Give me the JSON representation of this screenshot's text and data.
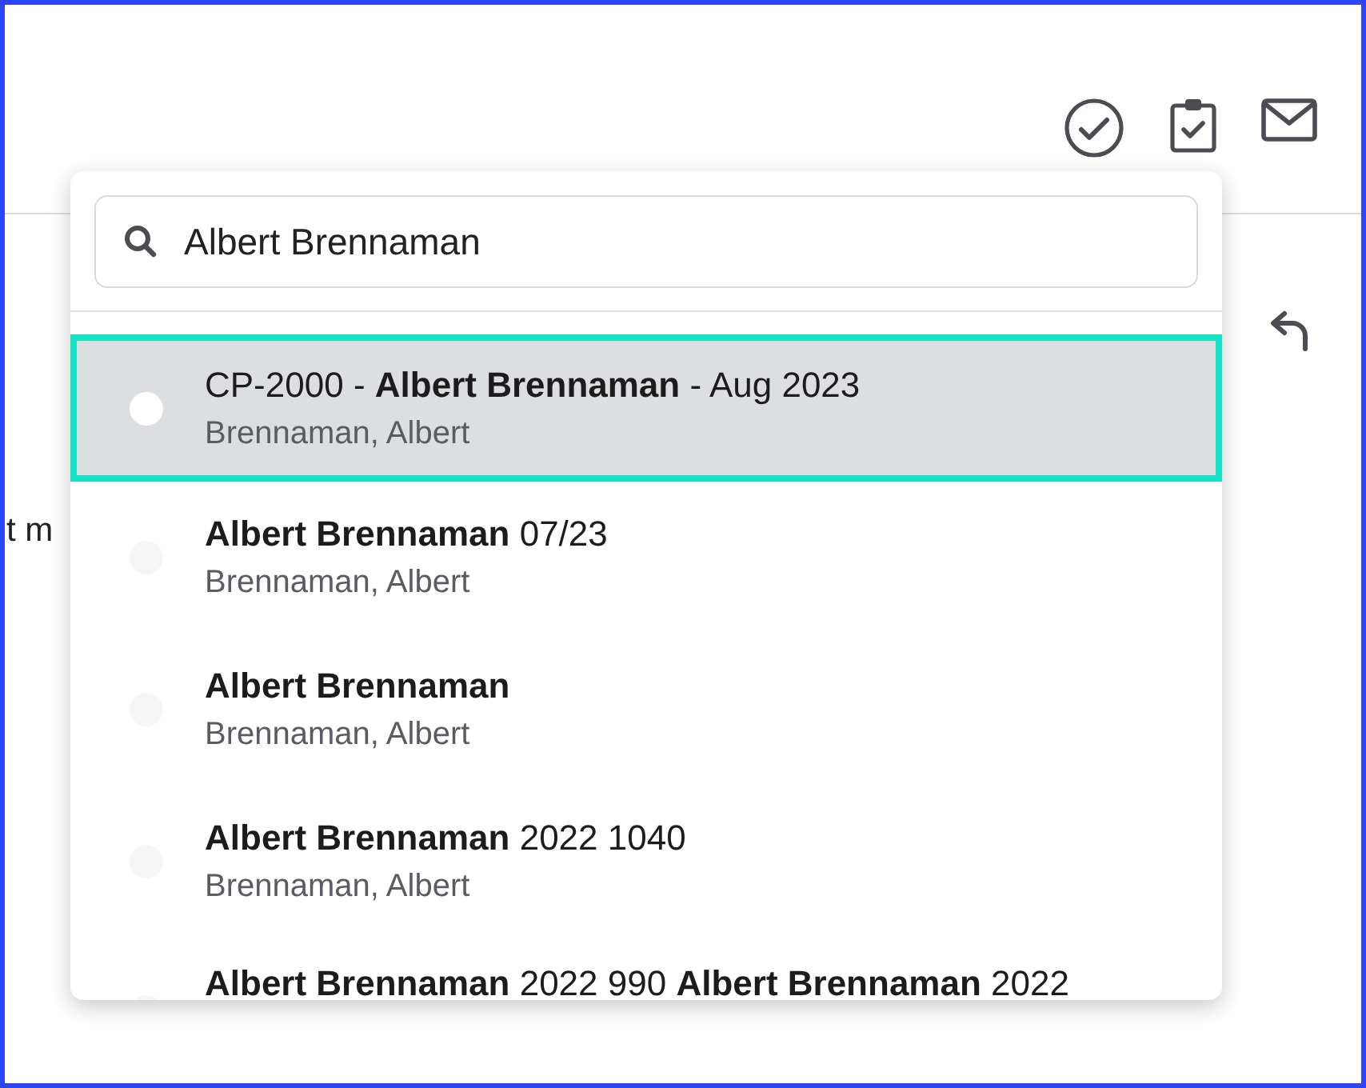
{
  "background_text": "t m",
  "search": {
    "value": "Albert Brennaman"
  },
  "results": [
    {
      "title": "CP-2000 - **Albert Brennaman** - Aug 2023",
      "subtitle": "Brennaman, Albert",
      "selected": true
    },
    {
      "title": "**Albert Brennaman** 07/23",
      "subtitle": "Brennaman, Albert",
      "selected": false
    },
    {
      "title": "**Albert Brennaman**",
      "subtitle": "Brennaman, Albert",
      "selected": false
    },
    {
      "title": "**Albert Brennaman** 2022 1040",
      "subtitle": "Brennaman, Albert",
      "selected": false
    },
    {
      "title": "**Albert Brennaman** 2022 990 **Albert Brennaman** 2022",
      "selected": false
    }
  ]
}
